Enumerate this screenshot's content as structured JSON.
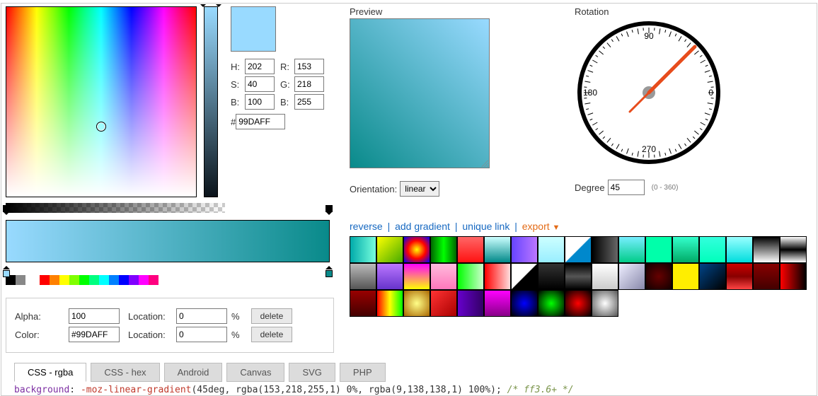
{
  "picker": {
    "h_label": "H:",
    "s_label": "S:",
    "b_label": "B:",
    "r_label": "R:",
    "g_label": "G:",
    "bl_label": "B:",
    "h": "202",
    "s": "40",
    "b": "100",
    "r": "153",
    "g": "218",
    "bl": "255",
    "hash": "#",
    "hex": "99DAFF",
    "cursor_pct_x": 50,
    "cursor_pct_y": 63
  },
  "preview": {
    "label": "Preview"
  },
  "orientation": {
    "label": "Orientation:",
    "value": "linear"
  },
  "rotation": {
    "label": "Rotation",
    "degree_label": "Degree",
    "value": "45",
    "range": "(0 - 360)",
    "dial_labels": {
      "top": "90",
      "right": "0",
      "bottom": "270",
      "left": "180"
    }
  },
  "links": {
    "reverse": "reverse",
    "add": "add gradient",
    "unique": "unique link",
    "export": "export"
  },
  "gradient": {
    "stops": [
      {
        "color": "#99DAFF",
        "pos": 0
      },
      {
        "color": "rgb(9,138,138)",
        "pos": 100
      }
    ]
  },
  "palette_left": [
    "#000",
    "#888"
  ],
  "palette_right": [
    "#f00",
    "#ff8000",
    "#ffff00",
    "#80ff00",
    "#0f0",
    "#00ff80",
    "#0ff",
    "#0080ff",
    "#00f",
    "#8000ff",
    "#f0f",
    "#ff0080"
  ],
  "stop_panel": {
    "alpha_label": "Alpha:",
    "alpha": "100",
    "color_label": "Color:",
    "color": "#99DAFF",
    "loc_label": "Location:",
    "loc_a": "0",
    "loc_b": "0",
    "pct": "%",
    "delete": "delete"
  },
  "tabs": [
    "CSS - rgba",
    "CSS - hex",
    "Android",
    "Canvas",
    "SVG",
    "PHP"
  ],
  "active_tab": 0,
  "code": {
    "prop": "background",
    "colon": ": ",
    "fn": "-moz-linear-gradient",
    "args_a": "(45deg,  rgba(153,218,255,1) 0%",
    "args_b": ", rgba(9,138,138,1) 100%);",
    "cmt": "/* ff3.6+ */"
  },
  "presets": [
    [
      "linear-gradient(90deg,#0aa,#7fd)",
      "linear-gradient(135deg,#ff0,#4a0)",
      "radial-gradient(circle,#ff0,#f00,#00f)",
      "linear-gradient(90deg,#060,#0f0,#060)",
      "linear-gradient(180deg,#f66,#f11)",
      "linear-gradient(180deg,#cff,#088)",
      "linear-gradient(90deg,#64f,#b7f)",
      "linear-gradient(180deg,#cff,#9ef)",
      "linear-gradient(135deg,#fff 49%,#08c 51%)",
      "linear-gradient(90deg,#000,#666)",
      "linear-gradient(180deg,#7ef,#0c8)",
      "linear-gradient(180deg,#0fa,#0fa)",
      "linear-gradient(180deg,#3fc,#0a6)",
      "linear-gradient(180deg,#3fd,#0fb)",
      "linear-gradient(180deg,#9ff,#0dd)",
      "linear-gradient(180deg,#000,#fff)",
      "linear-gradient(180deg,#fff,#000,#fff)"
    ],
    [
      "linear-gradient(180deg,#bbb,#555)",
      "linear-gradient(180deg,#b7f,#63c)",
      "linear-gradient(180deg,#f0f,#ff0)",
      "linear-gradient(180deg,#fbd,#f7b)",
      "linear-gradient(90deg,#0f0,#cfc)",
      "linear-gradient(90deg,#f00,#fdd)",
      "linear-gradient(135deg,#fff 49%,#000 51%)",
      "linear-gradient(180deg,#333,#000)",
      "linear-gradient(180deg,#000,#555,#000)",
      "linear-gradient(180deg,#fff,#ccc)",
      "linear-gradient(135deg,#eef,#88a)",
      "radial-gradient(circle,#600,#100)",
      "linear-gradient(180deg,#fe0,#fe0)",
      "linear-gradient(135deg,#048,#000)",
      "linear-gradient(180deg,#c00,#800,#f44)",
      "linear-gradient(180deg,#800,#400)",
      "linear-gradient(90deg,#f00,#000)"
    ],
    [
      "linear-gradient(180deg,#900,#400)",
      "linear-gradient(90deg,#f00,#ff0,#0f0)",
      "radial-gradient(circle,#ff8,#a60)",
      "linear-gradient(135deg,#f33,#a00)",
      "linear-gradient(90deg,#60c,#306)",
      "linear-gradient(180deg,#f0f,#808)",
      "radial-gradient(circle,#00f,#000)",
      "radial-gradient(circle,#0f0,#000)",
      "radial-gradient(circle,#f00,#000)",
      "radial-gradient(circle,#fff,#555)"
    ]
  ]
}
